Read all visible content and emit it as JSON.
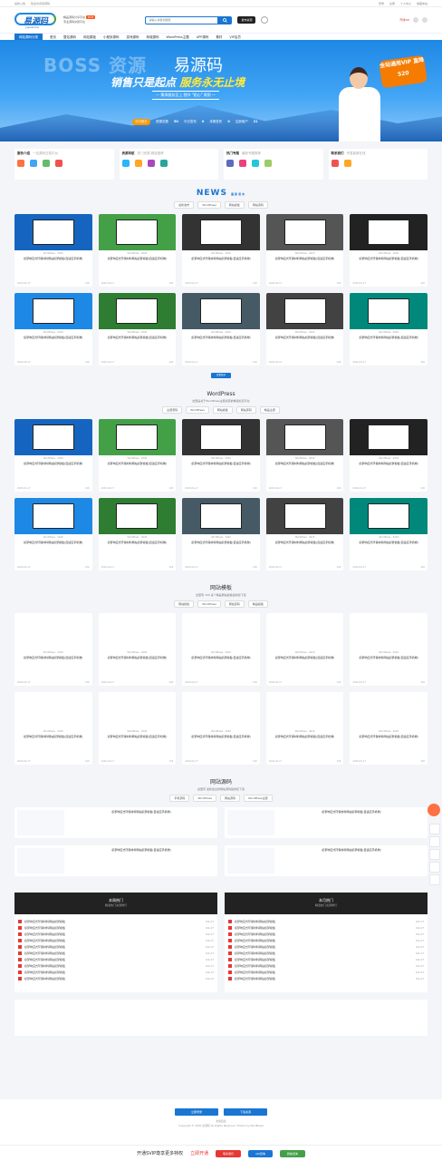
{
  "topbar": {
    "left": [
      "最新公告",
      "欢迎访问易源码"
    ],
    "right": [
      "登录",
      "注册",
      "个人中心",
      "收藏本站"
    ]
  },
  "header": {
    "logo_text": "易源码",
    "logo_sub": "yiyuanma",
    "slogan1": "精品源码分享平台",
    "hot": "HOT",
    "slogan2": "专业源码交易平台",
    "search_placeholder": "请输入关键词搜索",
    "publish": "发布资源",
    "vip": "开通VIP"
  },
  "nav": {
    "category": "网站源码分类",
    "items": [
      "首页",
      "整站源码",
      "网站模板",
      "小程序源码",
      "游戏源码",
      "商城源码",
      "WordPress主题",
      "APP源码",
      "素材",
      "VIP会员"
    ]
  },
  "banner": {
    "watermark": "BOSS 资源",
    "brand": "易源码",
    "slogan_a": "销售只是起点",
    "slogan_b": "服务永无止境",
    "pill": "一 秉承服务至上 细节 \"贴心\" 周到 一",
    "promo": "全站通用VIP 直降520",
    "stats_label": "今日统计",
    "stats": [
      {
        "label": "资源总数",
        "value": "50"
      },
      {
        "label": "今日发布",
        "value": "0"
      },
      {
        "label": "本周发布",
        "value": "0"
      },
      {
        "label": "注册用户",
        "value": "21"
      }
    ]
  },
  "categories": [
    {
      "title": "服务介绍",
      "sub": "一站源码交易平台",
      "colors": [
        "#ff7043",
        "#42a5f5",
        "#66bb6a",
        "#ef5350"
      ]
    },
    {
      "title": "资源导航",
      "sub": "热门资源 精选推荐",
      "colors": [
        "#29b6f6",
        "#ffa726",
        "#ab47bc",
        "#26a69a"
      ]
    },
    {
      "title": "热门专题",
      "sub": "最新专题推荐",
      "colors": [
        "#5c6bc0",
        "#ec407a",
        "#26c6da",
        "#9ccc65"
      ]
    },
    {
      "title": "联系我们",
      "sub": "专属客服在线",
      "colors": [
        "#ef5350",
        "#ffa726"
      ]
    }
  ],
  "news": {
    "title": "NEWS",
    "title2": "最新发布",
    "tabs": [
      "最新发布",
      "WordPress",
      "网站模板",
      "网站源码"
    ],
    "more": "查看更多"
  },
  "card": {
    "meta": "WordPress · 2020",
    "title": "织梦响应式环保材料网站织梦模板(自适应手机端)",
    "date": "2020-04-17",
    "views": "126"
  },
  "wp": {
    "title": "WordPress",
    "desc": "这里是关于WordPress主题资源的精选栏目平台",
    "tabs": [
      "主题源码",
      "WordPress",
      "网站模板",
      "网站源码",
      "精品主题"
    ]
  },
  "tpl": {
    "title": "网站模板",
    "desc": "这里有 100 多个精品网站模板提供您下载",
    "tabs": [
      "网站模板",
      "WordPress",
      "网站源码",
      "精品模板"
    ]
  },
  "src": {
    "title": "网站源码",
    "desc": "这里有 最新最全的网站源码提供您下载",
    "tabs": [
      "手机源码",
      "WordPress",
      "网站源码",
      "WordPress主题"
    ],
    "items": [
      "织梦响应式环保材料网站织梦模板(自适应手机端)",
      "织梦响应式环保材料网站织梦模板(自适应手机端)",
      "织梦响应式环保材料网站织梦模板(自适应手机端)",
      "织梦响应式环保材料网站织梦模板(自适应手机端)"
    ]
  },
  "rank": [
    {
      "title": "本周热门",
      "sub": "精选热门资源排行",
      "items": [
        "织梦响应式环保材料网站织梦模板",
        "织梦响应式环保材料网站织梦模板",
        "织梦响应式环保材料网站织梦模板",
        "织梦响应式环保材料网站织梦模板",
        "织梦响应式环保材料网站织梦模板",
        "织梦响应式环保材料网站织梦模板",
        "织梦响应式环保材料网站织梦模板",
        "织梦响应式环保材料网站织梦模板",
        "织梦响应式环保材料网站织梦模板",
        "织梦响应式环保材料网站织梦模板"
      ],
      "date": "04-17"
    },
    {
      "title": "本月热门",
      "sub": "精选热门资源排行",
      "items": [
        "织梦响应式环保材料网站织梦模板",
        "织梦响应式环保材料网站织梦模板",
        "织梦响应式环保材料网站织梦模板",
        "织梦响应式环保材料网站织梦模板",
        "织梦响应式环保材料网站织梦模板",
        "织梦响应式环保材料网站织梦模板",
        "织梦响应式环保材料网站织梦模板",
        "织梦响应式环保材料网站织梦模板",
        "织梦响应式环保材料网站织梦模板",
        "织梦响应式环保材料网站织梦模板"
      ],
      "date": "04-17"
    }
  ],
  "footer": {
    "btn1": "立即登录",
    "btn2": "下载资源",
    "links": "友情链接",
    "copyright": "Copyright © 2020 易源码 All Rights Reserved. Theme by WordPress"
  },
  "bottombar": {
    "text": "开通SVIP尊享更多特权",
    "link": "立即开通",
    "b1": "联系我们",
    "b2": "QQ咨询",
    "b3": "微信咨询"
  }
}
